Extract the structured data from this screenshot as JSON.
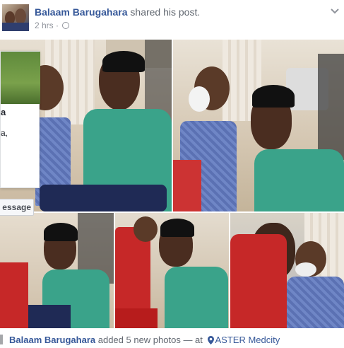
{
  "post": {
    "author": "Balaam Barugahara",
    "action": " shared his post.",
    "timestamp": "2 hrs",
    "separator": " · "
  },
  "overlay": {
    "text_fragment_1": "a",
    "text_fragment_2": "a,",
    "message_button": "essage"
  },
  "footer": {
    "author": "Balaam Barugahara",
    "action": " added 5 new photos — at ",
    "location": "ASTER Medcity"
  },
  "photos": [
    {
      "alt": "nurse-with-child-photo"
    },
    {
      "alt": "child-with-bandage-photo"
    },
    {
      "alt": "nurse-kneeling-photo"
    },
    {
      "alt": "gift-wrapped-photo"
    },
    {
      "alt": "man-and-child-photo"
    }
  ]
}
